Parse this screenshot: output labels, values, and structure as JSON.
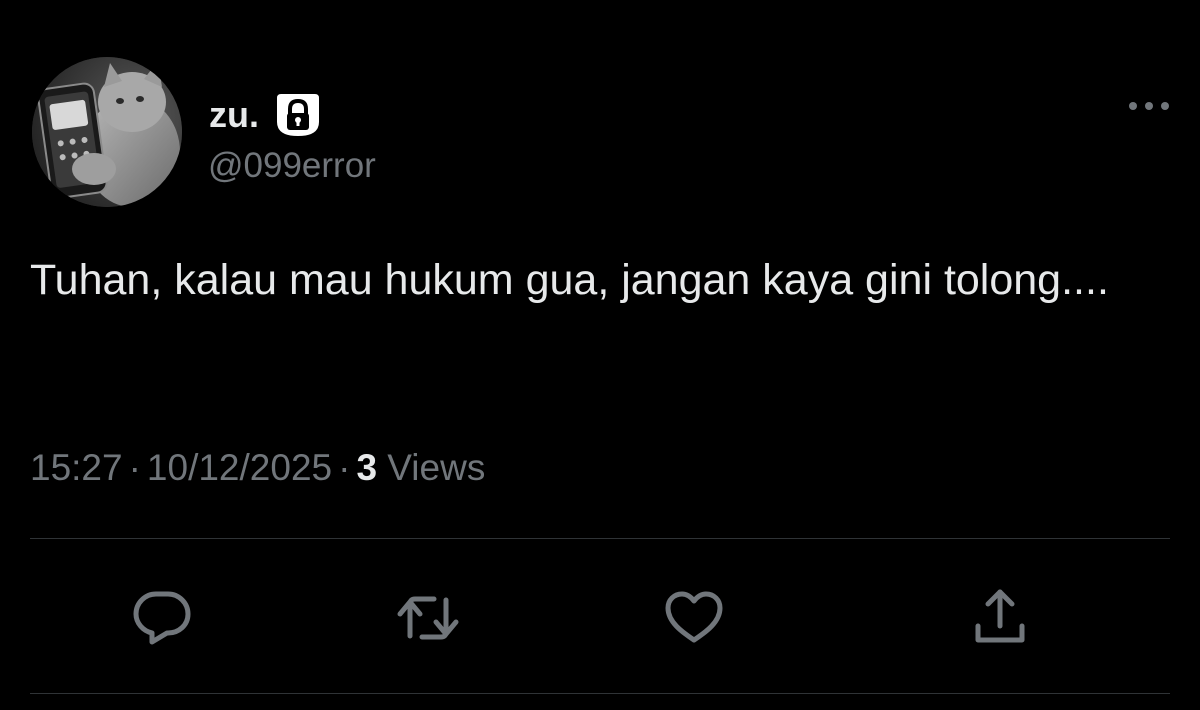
{
  "tweet": {
    "display_name": "zu.",
    "handle": "@099error",
    "text": "Tuhan, kalau mau hukum gua, jangan kaya gini tolong....",
    "time": "15:27",
    "date": "10/12/2025",
    "separator": "·",
    "views_count": "3",
    "views_label": "Views",
    "protected": true
  },
  "icons": {
    "lock": "lock-icon",
    "more": "more-horizontal-icon",
    "reply": "reply-icon",
    "retweet": "retweet-icon",
    "like": "heart-icon",
    "share": "share-icon"
  },
  "colors": {
    "background": "#000000",
    "primary_text": "#e7e9ea",
    "secondary_text": "#71767b",
    "divider": "#2f3336"
  }
}
